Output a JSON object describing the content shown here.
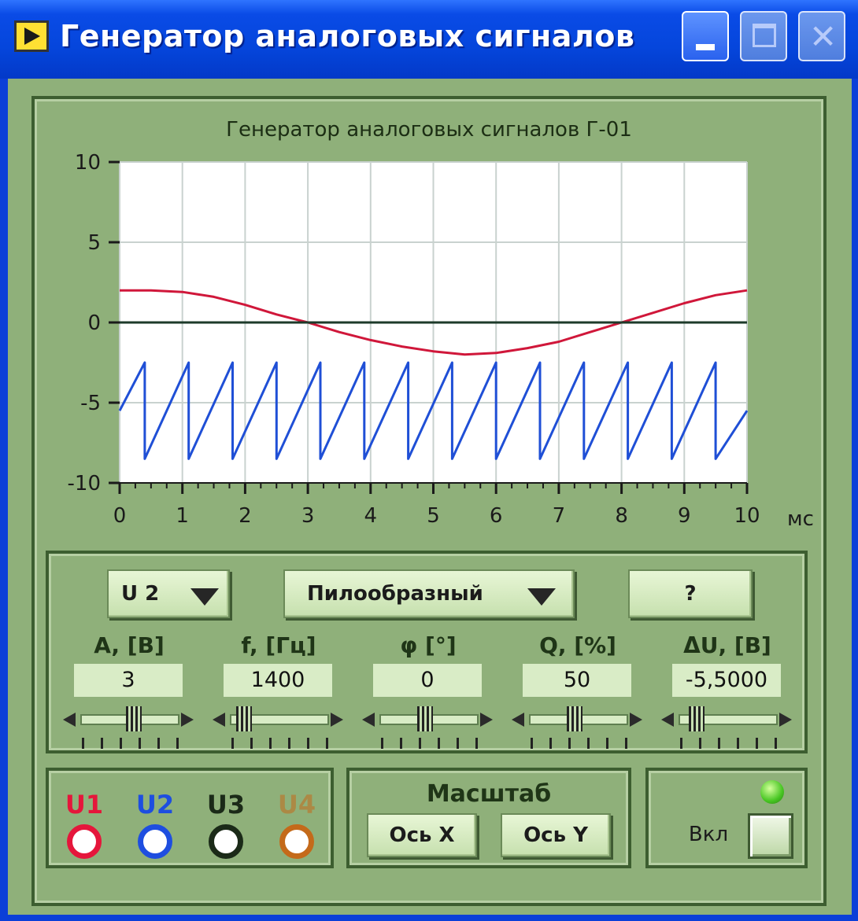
{
  "window": {
    "title": "Генератор аналоговых сигналов",
    "controls": [
      "minimize",
      "maximize",
      "close"
    ]
  },
  "chart_data": {
    "type": "line",
    "title": "Генератор аналоговых сигналов Г-01",
    "xlabel": "мс",
    "xlim": [
      0,
      10
    ],
    "ylim": [
      -10,
      10
    ],
    "x_ticks": [
      "0",
      "1",
      "2",
      "3",
      "4",
      "5",
      "6",
      "7",
      "8",
      "9",
      "10"
    ],
    "y_ticks": [
      "10",
      "5",
      "0",
      "-5",
      "-10"
    ],
    "grid": true,
    "series": [
      {
        "color": "#d0173a",
        "x": [
          0,
          0.5,
          1,
          1.5,
          2,
          2.5,
          3,
          3.5,
          4,
          4.5,
          5,
          5.5,
          6,
          6.5,
          7,
          7.5,
          8,
          8.5,
          9,
          9.5,
          10
        ],
        "y": [
          2,
          2,
          1.9,
          1.6,
          1.1,
          0.5,
          0,
          -0.6,
          -1.1,
          -1.5,
          -1.8,
          -2,
          -1.9,
          -1.6,
          -1.2,
          -0.6,
          0,
          0.6,
          1.2,
          1.7,
          2
        ]
      },
      {
        "color": "#1d3a2a",
        "x": [
          0,
          10
        ],
        "y": [
          0,
          0
        ]
      },
      {
        "color": "#1f4fd6",
        "x": [
          0,
          0.4,
          0.4,
          1.1,
          1.1,
          1.8,
          1.8,
          2.5,
          2.5,
          3.2,
          3.2,
          3.9,
          3.9,
          4.6,
          4.6,
          5.3,
          5.3,
          6.0,
          6.0,
          6.7,
          6.7,
          7.4,
          7.4,
          8.1,
          8.1,
          8.8,
          8.8,
          9.5,
          9.5,
          10
        ],
        "y": [
          -5.5,
          -2.5,
          -8.5,
          -2.5,
          -8.5,
          -2.5,
          -8.5,
          -2.5,
          -8.5,
          -2.5,
          -8.5,
          -2.5,
          -8.5,
          -2.5,
          -8.5,
          -2.5,
          -8.5,
          -2.5,
          -8.5,
          -2.5,
          -8.5,
          -2.5,
          -8.5,
          -2.5,
          -8.5,
          -2.5,
          -8.5,
          -2.5,
          -8.5,
          -5.5
        ]
      }
    ]
  },
  "controls": {
    "channel_select": "U 2",
    "waveform_select": "Пилообразный",
    "help_label": "?",
    "params": [
      {
        "label": "A, [В]",
        "value": "3",
        "level": 0.55
      },
      {
        "label": "f, [Гц]",
        "value": "1400",
        "level": 0.08
      },
      {
        "label": "φ [°]",
        "value": "0",
        "level": 0.45
      },
      {
        "label": "Q, [%]",
        "value": "50",
        "level": 0.45
      },
      {
        "label": "ΔU, [В]",
        "value": "-5,5000",
        "level": 0.12
      }
    ]
  },
  "outputs": {
    "jacks": [
      {
        "label": "U1",
        "color": "#e5163b"
      },
      {
        "label": "U2",
        "color": "#1e4ee0"
      },
      {
        "label": "U3",
        "color": "#1b2a18"
      },
      {
        "label": "U4",
        "color": "#c46a1a"
      }
    ]
  },
  "scale": {
    "title": "Масштаб",
    "x_axis": "Ось X",
    "y_axis": "Ось Y"
  },
  "power": {
    "label": "Вкл",
    "led_color": "#47c622"
  }
}
